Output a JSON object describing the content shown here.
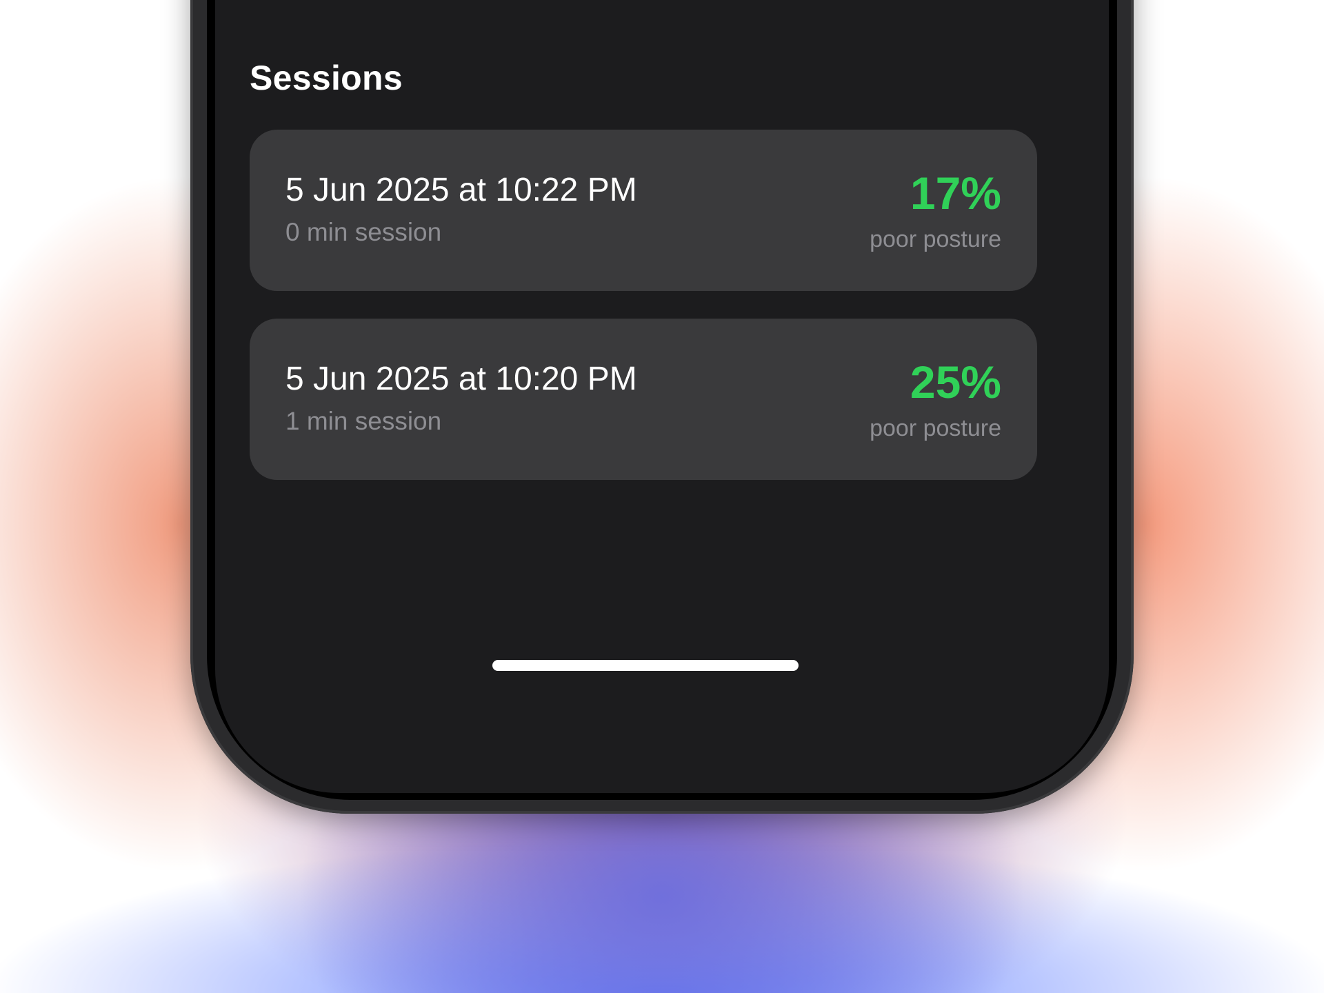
{
  "colors": {
    "screen_background": "#1c1c1e",
    "card_background": "#3a3a3c",
    "accent_green": "#30d158",
    "secondary_text": "#8e8e93"
  },
  "section": {
    "title": "Sessions"
  },
  "sessions": [
    {
      "date": "5 Jun 2025 at 10:22 PM",
      "duration": "0 min session",
      "score": "17%",
      "score_label": "poor posture"
    },
    {
      "date": "5 Jun 2025 at 10:20 PM",
      "duration": "1 min session",
      "score": "25%",
      "score_label": "poor posture"
    }
  ]
}
